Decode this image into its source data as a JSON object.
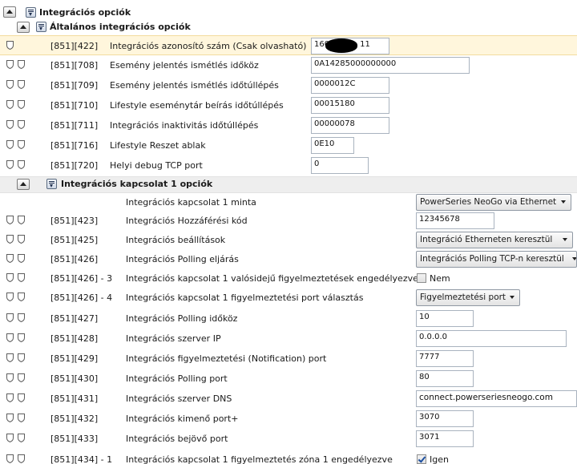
{
  "sections": {
    "top": {
      "title": "Integrációs opciók"
    },
    "general": {
      "title": "Általános integrációs opciók",
      "rows": [
        {
          "addr": "[851][422]",
          "label": "Integrációs azonosító szám (Csak olvasható)",
          "value_left": "160",
          "value_right": "11"
        },
        {
          "addr": "[851][708]",
          "label": "Esemény jelentés ismétlés időköz",
          "value": "0A14285000000000"
        },
        {
          "addr": "[851][709]",
          "label": "Esemény jelentés ismétlés időtúllépés",
          "value": "0000012C"
        },
        {
          "addr": "[851][710]",
          "label": "Lifestyle eseménytár beírás időtúllépés",
          "value": "00015180"
        },
        {
          "addr": "[851][711]",
          "label": "Integrációs inaktivitás időtúllépés",
          "value": "00000078"
        },
        {
          "addr": "[851][716]",
          "label": "Lifestyle Reszet ablak",
          "value": "0E10"
        },
        {
          "addr": "[851][720]",
          "label": "Helyi debug TCP port",
          "value": "0"
        }
      ]
    },
    "conn1": {
      "title": "Integrációs kapcsolat 1 opciók",
      "template_label": "Integrációs kapcsolat 1 minta",
      "template_value": "PowerSeries NeoGo via Ethernet",
      "rows": [
        {
          "addr": "[851][423]",
          "label": "Integrációs Hozzáférési kód",
          "value": "12345678"
        },
        {
          "addr": "[851][425]",
          "label": "Integrációs beállítások",
          "value": "Integráció Etherneten keresztül"
        },
        {
          "addr": "[851][426]",
          "label": "Integrációs Polling eljárás",
          "value": "Integrációs Polling TCP-n keresztül"
        },
        {
          "addr": "[851][426] - 3",
          "label": "Integrációs kapcsolat 1 valósidejű figyelmeztetések engedélyezve",
          "value": "Nem"
        },
        {
          "addr": "[851][426] - 4",
          "label": "Integrációs kapcsolat 1 figyelmeztetési port választás",
          "value": "Figyelmeztetési port"
        },
        {
          "addr": "[851][427]",
          "label": "Integrációs Polling időköz",
          "value": "10"
        },
        {
          "addr": "[851][428]",
          "label": "Integrációs szerver IP",
          "value": "0.0.0.0"
        },
        {
          "addr": "[851][429]",
          "label": "Integrációs figyelmeztetési (Notification) port",
          "value": "7777"
        },
        {
          "addr": "[851][430]",
          "label": "Integrációs Polling port",
          "value": "80"
        },
        {
          "addr": "[851][431]",
          "label": "Integrációs szerver DNS",
          "value": "connect.powerseriesneogo.com"
        },
        {
          "addr": "[851][432]",
          "label": "Integrációs kimenő port+",
          "value": "3070"
        },
        {
          "addr": "[851][433]",
          "label": "Integrációs bejövő port",
          "value": "3071"
        },
        {
          "addr": "[851][434] - 1",
          "label": "Integrációs kapcsolat 1 figyelmeztetés zóna 1 engedélyezve",
          "value": "Igen"
        }
      ]
    }
  },
  "colors": {
    "selected_row": "#fff6dc",
    "section_bg": "#eeeeee"
  }
}
